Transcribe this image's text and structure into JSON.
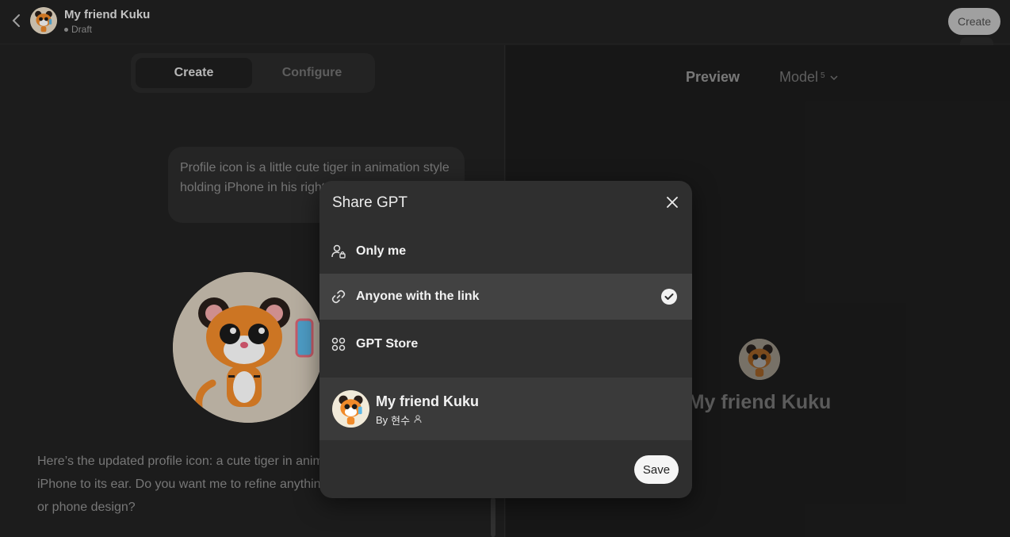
{
  "topbar": {
    "back_icon": "chevron-left-icon",
    "title": "My friend Kuku",
    "status": "Draft",
    "create_label": "Create",
    "markdown_icon": "M↓"
  },
  "editor": {
    "tabs": [
      {
        "label": "Create",
        "active": true
      },
      {
        "label": "Configure",
        "active": false
      }
    ],
    "user_message": "Profile icon is a little cute tiger in animation style holding iPhone in his right hand to his right ear.",
    "assistant_message": "Here’s the updated profile icon: a cute tiger in animation style holding an iPhone to its ear. Do you want me to refine anything, like the pose, expression, or phone design?"
  },
  "preview": {
    "preview_label": "Preview",
    "model_label": "Model",
    "model_version": "5",
    "gpt_name": "My friend Kuku"
  },
  "share_dialog": {
    "title": "Share GPT",
    "options": [
      {
        "label": "Only me",
        "icon": "user-lock-icon",
        "selected": false
      },
      {
        "label": "Anyone with the link",
        "icon": "link-icon",
        "selected": true
      },
      {
        "label": "GPT Store",
        "icon": "grid-icon",
        "selected": false
      }
    ],
    "gpt_card": {
      "name": "My friend Kuku",
      "by_prefix": "By",
      "author": "현수"
    },
    "save_label": "Save"
  },
  "colors": {
    "background": "#212121",
    "modal": "#2f2f2f",
    "selected_row": "#424242"
  }
}
